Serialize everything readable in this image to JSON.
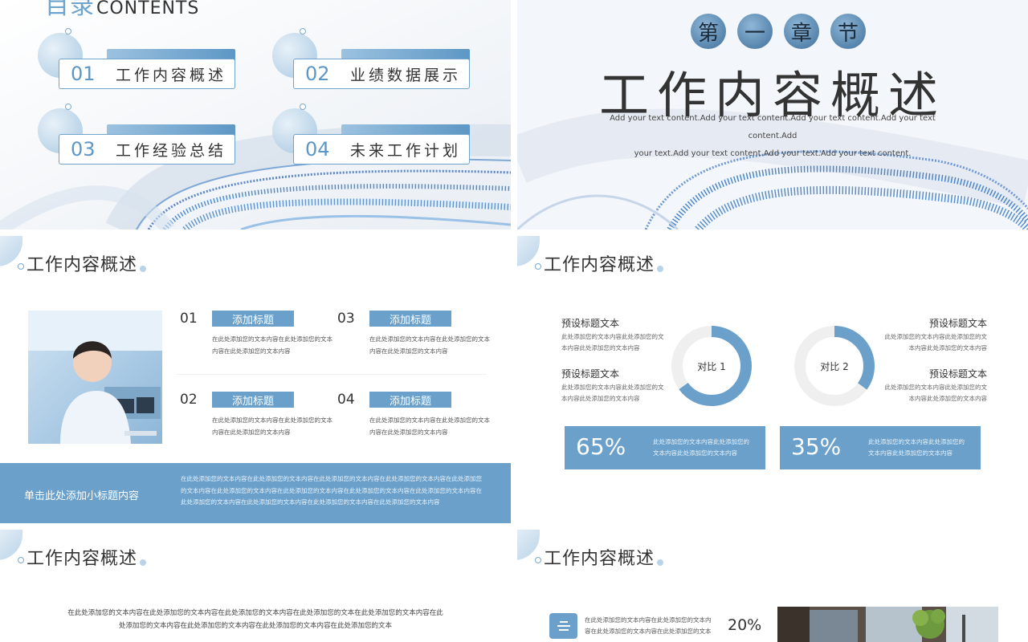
{
  "slide1": {
    "title_cn": "目录",
    "title_en": "CONTENTS",
    "items": [
      {
        "num": "01",
        "label": "工作内容概述"
      },
      {
        "num": "02",
        "label": "业绩数据展示"
      },
      {
        "num": "03",
        "label": "工作经验总结"
      },
      {
        "num": "04",
        "label": "未来工作计划"
      }
    ]
  },
  "slide2": {
    "chapter": [
      "第",
      "一",
      "章",
      "节"
    ],
    "title": "工作内容概述",
    "sub_line1": "Add your text content.Add your text content.Add your text content.Add your text content.Add",
    "sub_line2": "your text.Add your text content.Add your text.Add your text content."
  },
  "slide3": {
    "title": "工作内容概述",
    "items": [
      {
        "num": "01",
        "pill": "添加标题",
        "desc": "在此处添加您的文本内容在此处添加您的文本内容在此处添加您的文本内容"
      },
      {
        "num": "02",
        "pill": "添加标题",
        "desc": "在此处添加您的文本内容在此处添加您的文本内容在此处添加您的文本内容"
      },
      {
        "num": "03",
        "pill": "添加标题",
        "desc": "在此处添加您的文本内容在此处添加您的文本内容在此处添加您的文本内容"
      },
      {
        "num": "04",
        "pill": "添加标题",
        "desc": "在此处添加您的文本内容在此处添加您的文本内容在此处添加您的文本内容"
      }
    ],
    "band_title": "单击此处添加小标题内容",
    "band_text": "在此处添加您的文本内容在此处添加您的文本内容在此处添加您的文本内容在此处添加您的文本内容在此处添加您的文本内容在此处添加您的文本内容在此处添加您的文本内容在此处添加您的文本内容在此处添加您的文本内容在此处添加您的文本内容在此处添加您的文本内容在此处添加您的文本内容在此处添加您的文本内容"
  },
  "slide4": {
    "title": "工作内容概述",
    "presets": [
      {
        "h": "预设标题文本",
        "b": "此处添加您的文本内容此处添加您的文本内容此处添加您的文本内容"
      },
      {
        "h": "预设标题文本",
        "b": "此处添加您的文本内容此处添加您的文本内容此处添加您的文本内容"
      },
      {
        "h": "预设标题文本",
        "b": "此处添加您的文本内容此处添加您的文本内容此处添加您的文本内容"
      },
      {
        "h": "预设标题文本",
        "b": "此处添加您的文本内容此处添加您的文本内容此处添加您的文本内容"
      }
    ],
    "rings": [
      {
        "label": "对比 1",
        "value": 0.65
      },
      {
        "label": "对比 2",
        "value": 0.35
      }
    ],
    "stats": [
      {
        "pct": "65%",
        "text": "此处添加您的文本内容此处添加您的文本内容此处添加您的文本内容"
      },
      {
        "pct": "35%",
        "text": "此处添加您的文本内容此处添加您的文本内容此处添加您的文本内容"
      }
    ]
  },
  "slide5": {
    "title": "工作内容概述",
    "text_line1": "在此处添加您的文本内容在此处添加您的文本内容在此处添加您的文本内容在此处添加您的文本在此处添加您的文本内容在此",
    "text_line2": "处添加您的文本内容在此处添加您的文本内容在此处添加您的文本内容在此处添加您的文本"
  },
  "slide6": {
    "title": "工作内容概述",
    "text": "在此处添加您的文本内容在此处添加您的文本内容在此处添加您的文本内容在此处添加您的文本",
    "pct": "20%"
  },
  "colors": {
    "accent": "#6aa0c9",
    "accent_dark": "#3f6f9a",
    "track": "#efefef"
  }
}
